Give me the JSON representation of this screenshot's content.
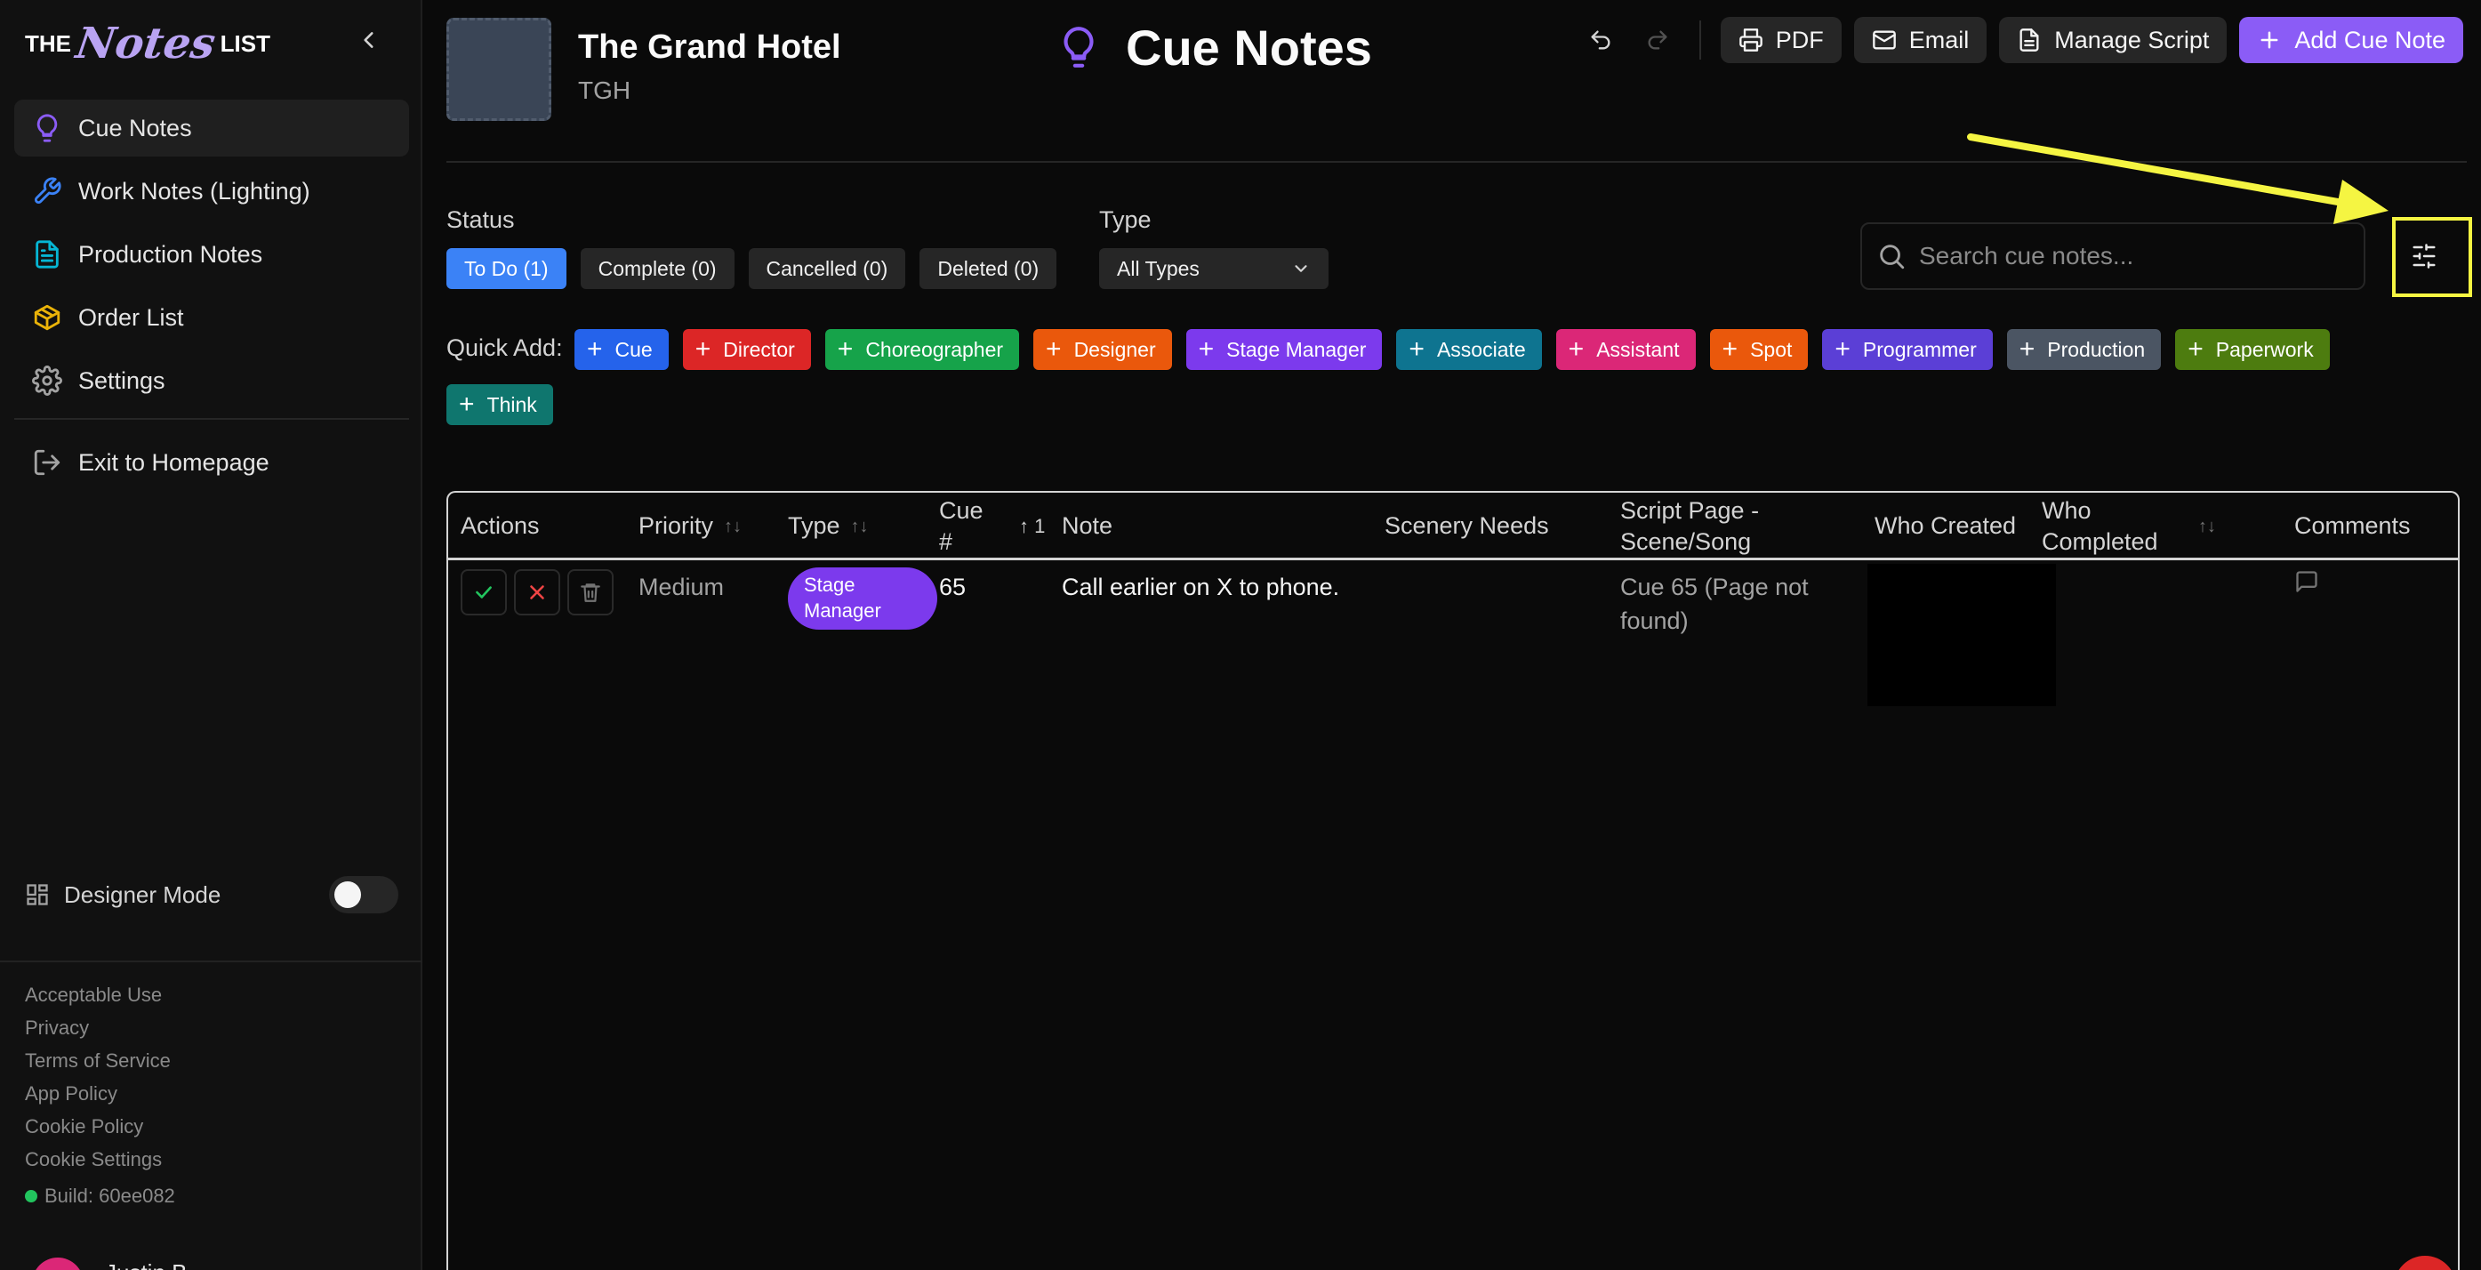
{
  "logo": {
    "the": "THE",
    "notes": "Notes",
    "list": "LIST"
  },
  "sidebar": {
    "items": [
      {
        "label": "Cue Notes",
        "icon": "lightbulb-icon",
        "active": true
      },
      {
        "label": "Work Notes (Lighting)",
        "icon": "wrench-icon"
      },
      {
        "label": "Production Notes",
        "icon": "file-text-icon"
      },
      {
        "label": "Order List",
        "icon": "package-icon"
      },
      {
        "label": "Settings",
        "icon": "gear-icon"
      }
    ],
    "exit": "Exit to Homepage",
    "designer_mode": "Designer Mode",
    "designer_mode_on": false,
    "footer_links": [
      "Acceptable Use",
      "Privacy",
      "Terms of Service",
      "App Policy",
      "Cookie Policy",
      "Cookie Settings"
    ],
    "build": "Build: 60ee082",
    "user_partial": "Justin B..."
  },
  "header": {
    "show_title": "The Grand Hotel",
    "show_abbr": "TGH",
    "page_title": "Cue Notes",
    "buttons": {
      "pdf": "PDF",
      "email": "Email",
      "manage_script": "Manage Script",
      "add": "Add Cue Note"
    }
  },
  "filters": {
    "status_label": "Status",
    "status": [
      "To Do (1)",
      "Complete (0)",
      "Cancelled (0)",
      "Deleted (0)"
    ],
    "type_label": "Type",
    "type_value": "All Types",
    "search_placeholder": "Search cue notes..."
  },
  "quick_add": {
    "label": "Quick Add:",
    "items": [
      {
        "label": "Cue",
        "color": "#2563eb"
      },
      {
        "label": "Director",
        "color": "#dc2626"
      },
      {
        "label": "Choreographer",
        "color": "#16a34a"
      },
      {
        "label": "Designer",
        "color": "#ea580c"
      },
      {
        "label": "Stage Manager",
        "color": "#7c3aed"
      },
      {
        "label": "Associate",
        "color": "#0e7490"
      },
      {
        "label": "Assistant",
        "color": "#db2777"
      },
      {
        "label": "Spot",
        "color": "#ea580c"
      },
      {
        "label": "Programmer",
        "color": "#5b3fd6"
      },
      {
        "label": "Production",
        "color": "#4b5563"
      },
      {
        "label": "Paperwork",
        "color": "#4d7c0f"
      },
      {
        "label": "Think",
        "color": "#0f766e"
      }
    ]
  },
  "table": {
    "headers": {
      "actions": "Actions",
      "priority": "Priority",
      "type": "Type",
      "cue_a": "Cue",
      "cue_b": "#",
      "cue_sort": "↑ 1",
      "note": "Note",
      "scenery": "Scenery Needs",
      "script_a": "Script Page -",
      "script_b": "Scene/Song",
      "who_created": "Who Created",
      "who_completed_a": "Who",
      "who_completed_b": "Completed",
      "comments": "Comments"
    },
    "rows": [
      {
        "priority": "Medium",
        "type_a": "Stage",
        "type_b": "Manager",
        "cue": "65",
        "note": "Call earlier on X to phone.",
        "script_a": "Cue 65 (Page not",
        "script_b": "found)"
      }
    ]
  }
}
